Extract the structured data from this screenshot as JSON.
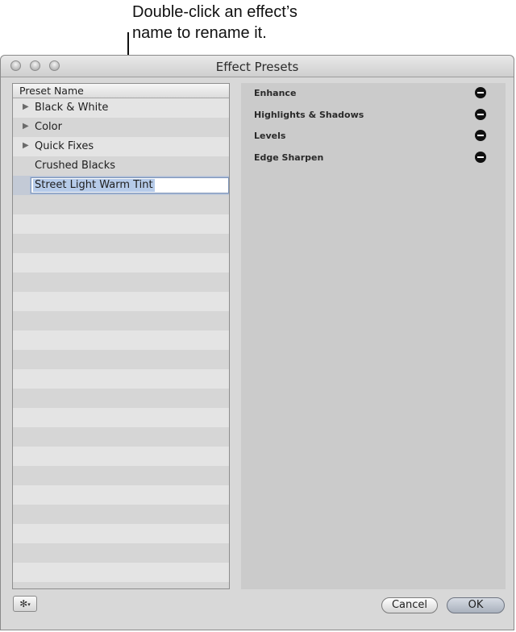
{
  "callout": {
    "line1": "Double-click an effect’s",
    "line2": "name to rename it."
  },
  "window": {
    "title": "Effect Presets"
  },
  "list": {
    "header": "Preset Name",
    "rows": [
      {
        "label": "Black & White",
        "disclosure": true
      },
      {
        "label": "Color",
        "disclosure": true
      },
      {
        "label": "Quick Fixes",
        "disclosure": true
      },
      {
        "label": "Crushed Blacks",
        "disclosure": false
      },
      {
        "label": "Street Light Warm Tint",
        "disclosure": false,
        "editing": true
      }
    ]
  },
  "effects": [
    {
      "name": "Enhance"
    },
    {
      "name": "Highlights & Shadows"
    },
    {
      "name": "Levels"
    },
    {
      "name": "Edge Sharpen"
    }
  ],
  "buttons": {
    "cancel": "Cancel",
    "ok": "OK"
  },
  "icons": {
    "disclosure": "disclosure-triangle-icon",
    "remove": "remove-minus-icon",
    "gear": "gear-icon"
  }
}
